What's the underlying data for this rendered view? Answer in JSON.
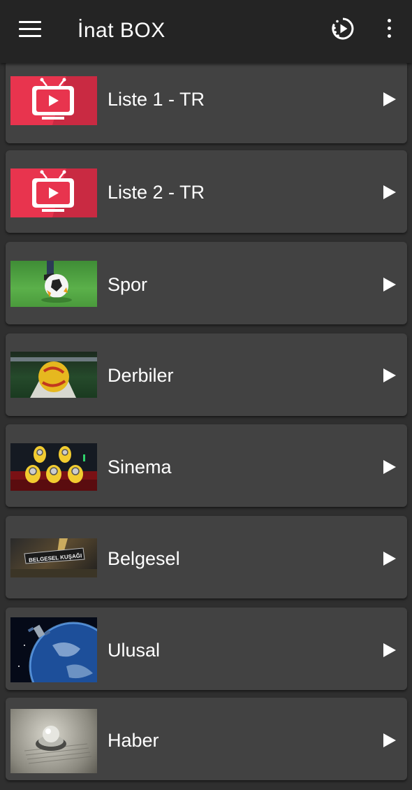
{
  "app": {
    "title": "İnat BOX"
  },
  "toolbar": {
    "menu_icon": "menu-icon",
    "play_icon": "play-circle-icon",
    "more_icon": "more-vert-icon"
  },
  "colors": {
    "appbar": "#242424",
    "background": "#2f2f2f",
    "card": "#424242",
    "tv_red": "#e8344e"
  },
  "items": [
    {
      "label": "Liste 1 - TR",
      "thumbnail": "tv-icon"
    },
    {
      "label": "Liste 2 - TR",
      "thumbnail": "tv-icon"
    },
    {
      "label": "Spor",
      "thumbnail": "football-grass-image"
    },
    {
      "label": "Derbiler",
      "thumbnail": "stadium-ball-image"
    },
    {
      "label": "Sinema",
      "thumbnail": "cinema-minions-image"
    },
    {
      "label": "Belgesel",
      "thumbnail": "belgesel-kusagi-image",
      "thumb_text": "BELGESEL KUŞAĞI"
    },
    {
      "label": "Ulusal",
      "thumbnail": "earth-satellite-image"
    },
    {
      "label": "Haber",
      "thumbnail": "news-paper-image"
    }
  ]
}
